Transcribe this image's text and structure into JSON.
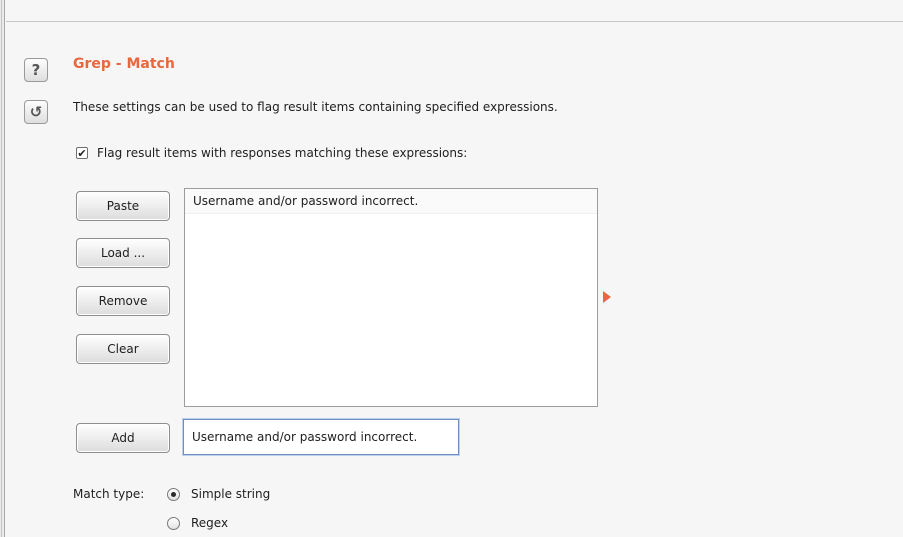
{
  "section": {
    "title": "Grep - Match",
    "description": "These settings can be used to flag result items containing specified expressions.",
    "help_icon": "?",
    "restore_icon": "↺"
  },
  "flag_option": {
    "checked": true,
    "label": "Flag result items with responses matching these expressions:"
  },
  "buttons": {
    "paste": "Paste",
    "load": "Load ...",
    "remove": "Remove",
    "clear": "Clear",
    "add": "Add"
  },
  "expressions": [
    "Username and/or password incorrect."
  ],
  "add_field": {
    "value": "Username and/or password incorrect."
  },
  "match_type": {
    "label": "Match type:",
    "options": [
      {
        "label": "Simple string",
        "selected": true
      },
      {
        "label": "Regex",
        "selected": false
      }
    ]
  },
  "colors": {
    "accent": "#e8673c"
  }
}
